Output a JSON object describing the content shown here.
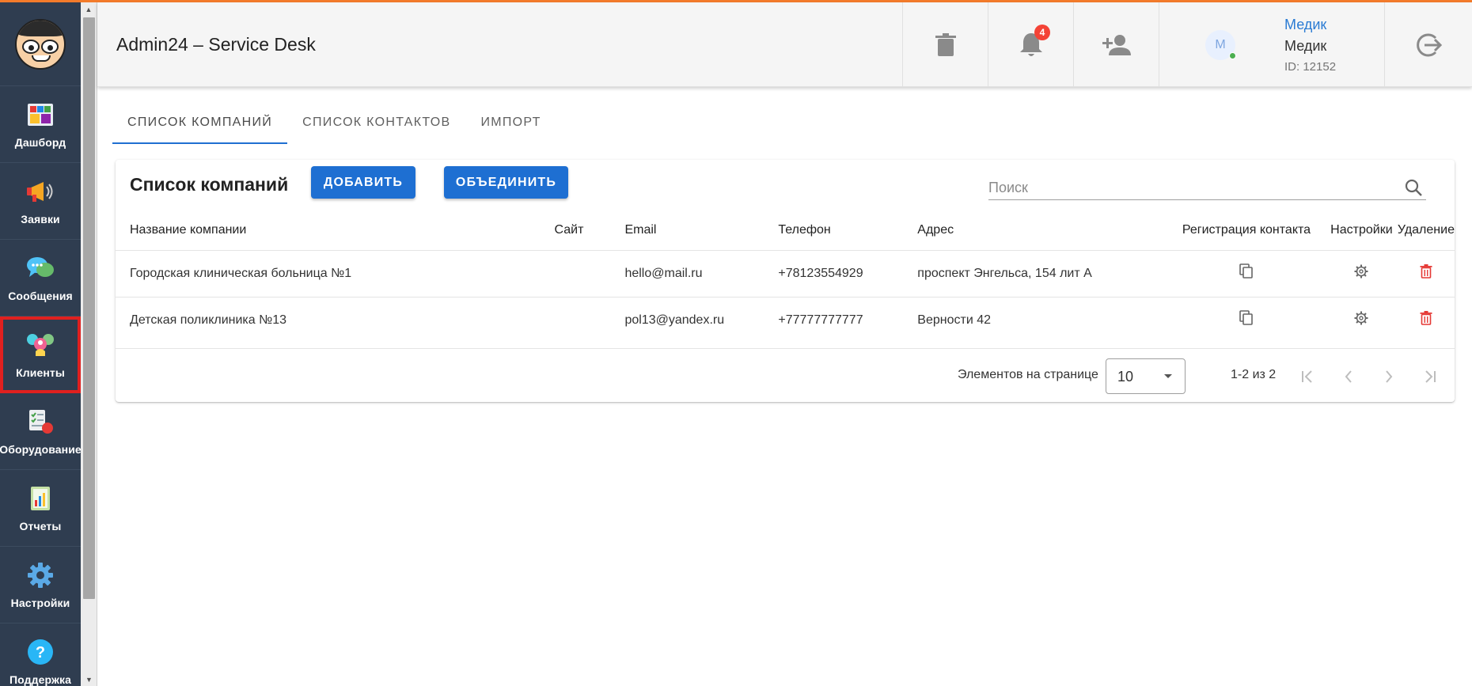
{
  "colors": {
    "accent_top": "#f37b2b",
    "sidebar_bg": "#2f3d50",
    "primary": "#1e6fd2",
    "active_outline": "#e0201f",
    "danger": "#e53935",
    "badge": "#f44336",
    "online": "#4caf50"
  },
  "sidebar": {
    "logo_icon": "cartoon-face-logo",
    "items": [
      {
        "label": "Дашборд",
        "icon": "dashboard-tiles-icon"
      },
      {
        "label": "Заявки",
        "icon": "megaphone-icon"
      },
      {
        "label": "Сообщения",
        "icon": "chat-bubbles-icon"
      },
      {
        "label": "Клиенты",
        "icon": "clients-group-icon",
        "active": true
      },
      {
        "label": "Оборудование",
        "icon": "equipment-checklist-icon"
      },
      {
        "label": "Отчеты",
        "icon": "report-chart-icon"
      },
      {
        "label": "Настройки",
        "icon": "gear-icon"
      },
      {
        "label": "Поддержка",
        "icon": "help-question-icon"
      }
    ]
  },
  "header": {
    "title": "Admin24 – Service Desk",
    "notifications_count": "4",
    "user": {
      "avatar_letter": "М",
      "link_name": "Медик",
      "name": "Медик",
      "id": "ID: 12152"
    }
  },
  "tabs": [
    {
      "label": "СПИСОК КОМПАНИЙ",
      "active": true
    },
    {
      "label": "СПИСОК КОНТАКТОВ",
      "active": false
    },
    {
      "label": "ИМПОРТ",
      "active": false
    }
  ],
  "card": {
    "title": "Список компаний",
    "add_label": "ДОБАВИТЬ",
    "merge_label": "ОБЪЕДИНИТЬ",
    "search_placeholder": "Поиск"
  },
  "table": {
    "columns": [
      "Название компании",
      "Сайт",
      "Email",
      "Телефон",
      "Адрес",
      "Регистрация контакта",
      "Настройки",
      "Удаление"
    ],
    "rows": [
      {
        "name": "Городская клиническая больница №1",
        "site": "",
        "email": "hello@mail.ru",
        "phone": "+78123554929",
        "address": "проспект Энгельса, 154 лит А"
      },
      {
        "name": "Детская поликлиника №13",
        "site": "",
        "email": "pol13@yandex.ru",
        "phone": "+77777777777",
        "address": "Верности 42"
      }
    ]
  },
  "pagination": {
    "per_page_label": "Элементов на странице",
    "per_page_value": "10",
    "range": "1-2 из 2"
  }
}
